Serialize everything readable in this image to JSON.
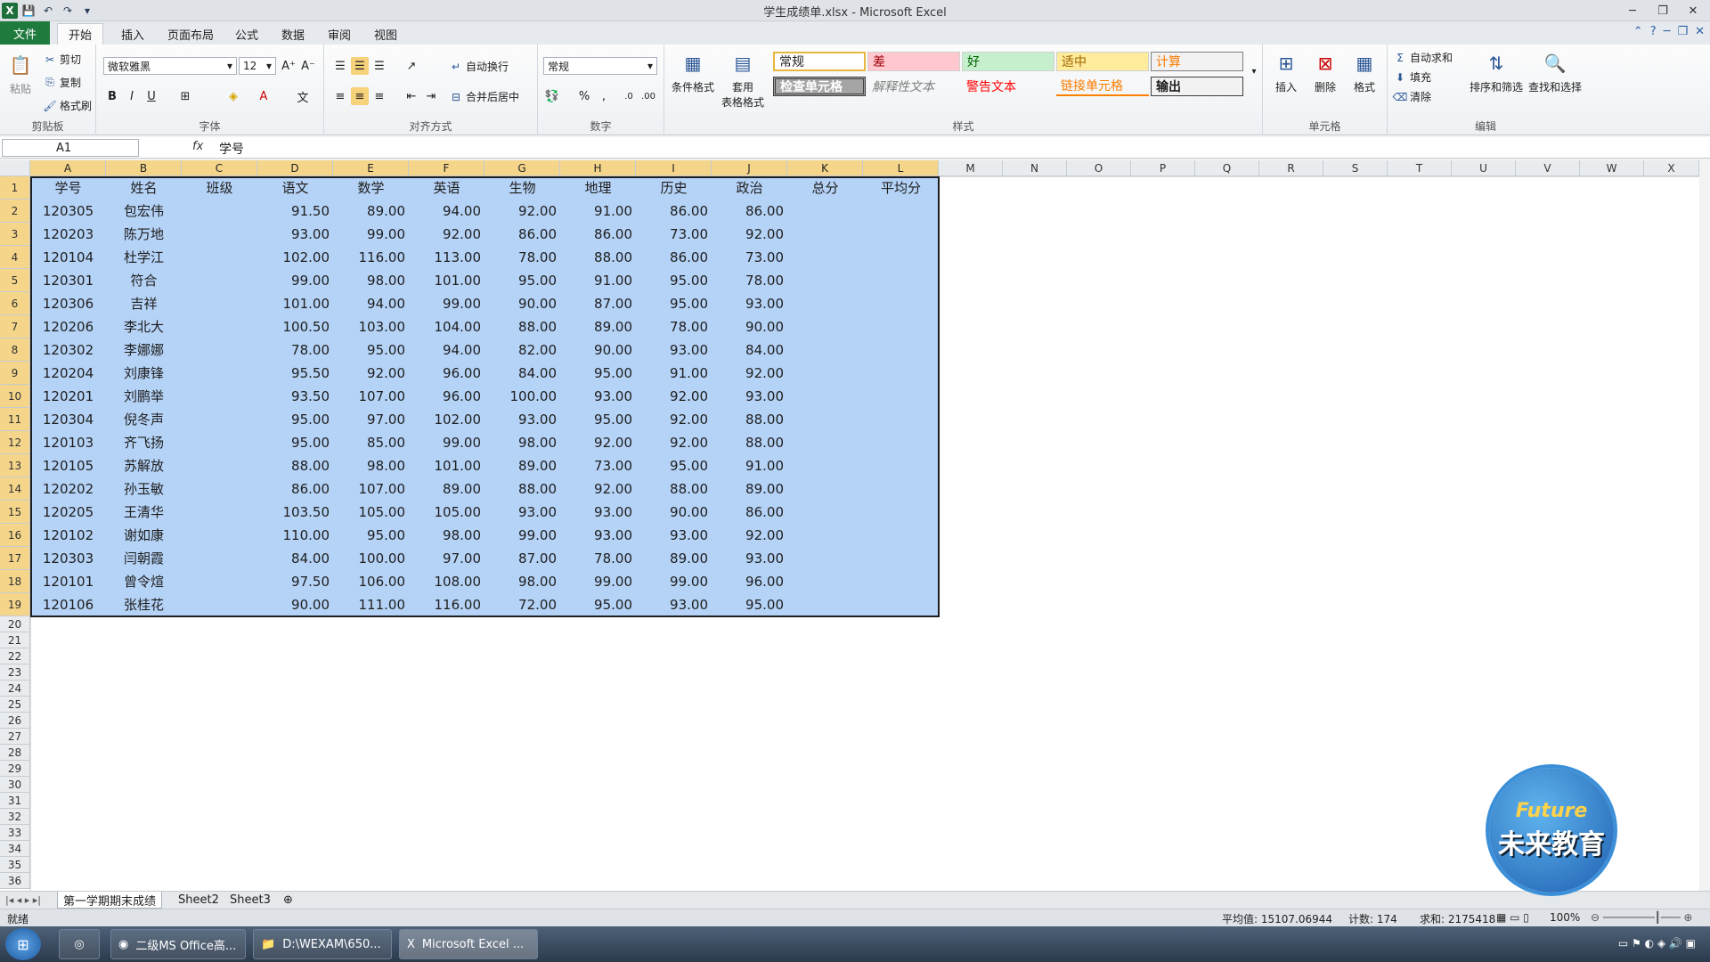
{
  "title": "学生成绩单.xlsx - Microsoft Excel",
  "ribbon_tabs": [
    "文件",
    "开始",
    "插入",
    "页面布局",
    "公式",
    "数据",
    "审阅",
    "视图"
  ],
  "clipboard": {
    "paste": "粘贴",
    "cut": "剪切",
    "copy": "复制",
    "format_painter": "格式刷",
    "label": "剪贴板"
  },
  "font": {
    "name": "微软雅黑",
    "size": "12",
    "label": "字体"
  },
  "alignment": {
    "wrap": "自动换行",
    "merge": "合并后居中",
    "label": "对齐方式"
  },
  "number": {
    "format": "常规",
    "label": "数字"
  },
  "styles": {
    "conditional": "条件格式",
    "table_format": "套用\n表格格式",
    "cells": [
      "常规",
      "差",
      "好",
      "适中",
      "计算",
      "检查单元格",
      "解释性文本",
      "警告文本",
      "链接单元格",
      "输出"
    ],
    "label": "样式"
  },
  "cells_group": {
    "insert": "插入",
    "delete": "删除",
    "format": "格式",
    "label": "单元格"
  },
  "editing": {
    "autosum": "自动求和",
    "fill": "填充",
    "clear": "清除",
    "sort": "排序和筛选",
    "find": "查找和选择",
    "label": "编辑"
  },
  "formula_bar": {
    "name_box": "A1",
    "fx": "fx",
    "content": "学号"
  },
  "columns": [
    "A",
    "B",
    "C",
    "D",
    "E",
    "F",
    "G",
    "H",
    "I",
    "J",
    "K",
    "L",
    "M",
    "N",
    "O",
    "P",
    "Q",
    "R",
    "S",
    "T",
    "U",
    "V",
    "W",
    "X"
  ],
  "rows_visible": [
    "1",
    "2",
    "3",
    "4",
    "5",
    "6",
    "7",
    "8",
    "9",
    "10",
    "11",
    "12",
    "13",
    "14",
    "15",
    "16",
    "17",
    "18",
    "19",
    "20",
    "21",
    "22",
    "23",
    "24",
    "25",
    "26",
    "27",
    "28",
    "29",
    "30",
    "31",
    "32",
    "33",
    "34",
    "35",
    "36"
  ],
  "table": {
    "headers": [
      "学号",
      "姓名",
      "班级",
      "语文",
      "数学",
      "英语",
      "生物",
      "地理",
      "历史",
      "政治",
      "总分",
      "平均分"
    ],
    "rows": [
      [
        "120305",
        "包宏伟",
        "",
        "91.50",
        "89.00",
        "94.00",
        "92.00",
        "91.00",
        "86.00",
        "86.00",
        "",
        ""
      ],
      [
        "120203",
        "陈万地",
        "",
        "93.00",
        "99.00",
        "92.00",
        "86.00",
        "86.00",
        "73.00",
        "92.00",
        "",
        ""
      ],
      [
        "120104",
        "杜学江",
        "",
        "102.00",
        "116.00",
        "113.00",
        "78.00",
        "88.00",
        "86.00",
        "73.00",
        "",
        ""
      ],
      [
        "120301",
        "符合",
        "",
        "99.00",
        "98.00",
        "101.00",
        "95.00",
        "91.00",
        "95.00",
        "78.00",
        "",
        ""
      ],
      [
        "120306",
        "吉祥",
        "",
        "101.00",
        "94.00",
        "99.00",
        "90.00",
        "87.00",
        "95.00",
        "93.00",
        "",
        ""
      ],
      [
        "120206",
        "李北大",
        "",
        "100.50",
        "103.00",
        "104.00",
        "88.00",
        "89.00",
        "78.00",
        "90.00",
        "",
        ""
      ],
      [
        "120302",
        "李娜娜",
        "",
        "78.00",
        "95.00",
        "94.00",
        "82.00",
        "90.00",
        "93.00",
        "84.00",
        "",
        ""
      ],
      [
        "120204",
        "刘康锋",
        "",
        "95.50",
        "92.00",
        "96.00",
        "84.00",
        "95.00",
        "91.00",
        "92.00",
        "",
        ""
      ],
      [
        "120201",
        "刘鹏举",
        "",
        "93.50",
        "107.00",
        "96.00",
        "100.00",
        "93.00",
        "92.00",
        "93.00",
        "",
        ""
      ],
      [
        "120304",
        "倪冬声",
        "",
        "95.00",
        "97.00",
        "102.00",
        "93.00",
        "95.00",
        "92.00",
        "88.00",
        "",
        ""
      ],
      [
        "120103",
        "齐飞扬",
        "",
        "95.00",
        "85.00",
        "99.00",
        "98.00",
        "92.00",
        "92.00",
        "88.00",
        "",
        ""
      ],
      [
        "120105",
        "苏解放",
        "",
        "88.00",
        "98.00",
        "101.00",
        "89.00",
        "73.00",
        "95.00",
        "91.00",
        "",
        ""
      ],
      [
        "120202",
        "孙玉敏",
        "",
        "86.00",
        "107.00",
        "89.00",
        "88.00",
        "92.00",
        "88.00",
        "89.00",
        "",
        ""
      ],
      [
        "120205",
        "王清华",
        "",
        "103.50",
        "105.00",
        "105.00",
        "93.00",
        "93.00",
        "90.00",
        "86.00",
        "",
        ""
      ],
      [
        "120102",
        "谢如康",
        "",
        "110.00",
        "95.00",
        "98.00",
        "99.00",
        "93.00",
        "93.00",
        "92.00",
        "",
        ""
      ],
      [
        "120303",
        "闫朝霞",
        "",
        "84.00",
        "100.00",
        "97.00",
        "87.00",
        "78.00",
        "89.00",
        "93.00",
        "",
        ""
      ],
      [
        "120101",
        "曾令煊",
        "",
        "97.50",
        "106.00",
        "108.00",
        "98.00",
        "99.00",
        "99.00",
        "96.00",
        "",
        ""
      ],
      [
        "120106",
        "张桂花",
        "",
        "90.00",
        "111.00",
        "116.00",
        "72.00",
        "95.00",
        "93.00",
        "95.00",
        "",
        ""
      ]
    ]
  },
  "sheets": [
    "第一学期期末成绩",
    "Sheet2",
    "Sheet3"
  ],
  "status": {
    "ready": "就绪",
    "average": "平均值: 15107.06944",
    "count": "计数: 174",
    "sum": "求和: 2175418",
    "zoom": "100%"
  },
  "taskbar": {
    "items": [
      "二级MS Office高...",
      "D:\\WEXAM\\650...",
      "Microsoft Excel ..."
    ]
  },
  "logo": {
    "line1": "Future",
    "line2": "未来教育"
  },
  "colors": {
    "selection": "#b5d3f7",
    "file_tab": "#1f7a3e",
    "header_highlight": "#f4d58a"
  }
}
